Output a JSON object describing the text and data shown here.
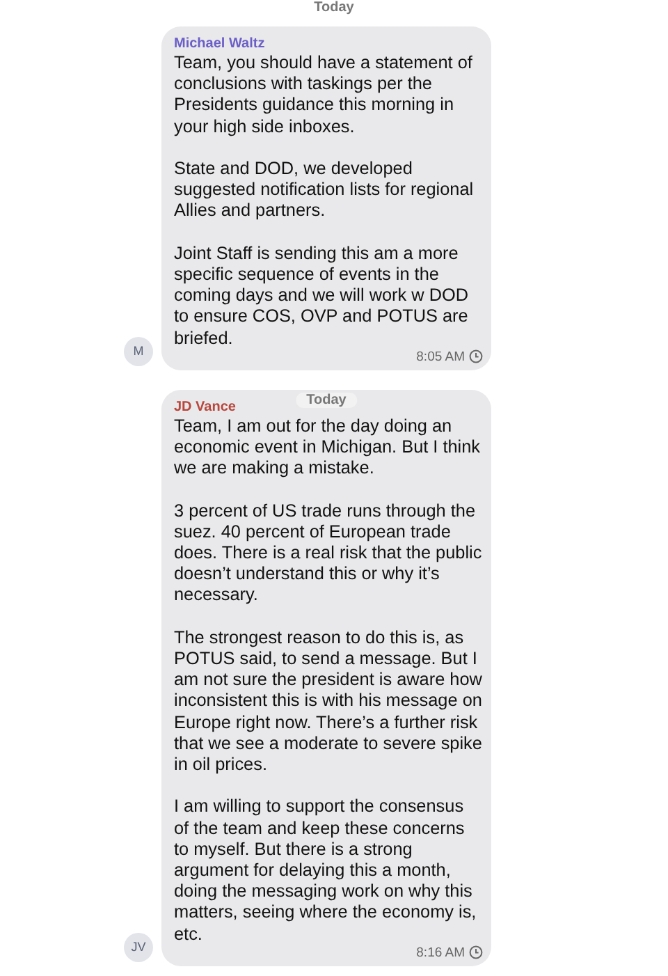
{
  "header_date": "Today",
  "messages": [
    {
      "sender": "Michael Waltz",
      "color": "#6b5fc7",
      "avatar": "M",
      "paragraphs": [
        "Team, you should have a statement of conclusions with taskings per the Presidents guidance this morning in your high side inboxes.",
        "State and DOD, we developed suggested notification lists for regional Allies and partners.",
        "Joint Staff is sending this am a more specific sequence of events in the coming days and we will work w DOD to ensure COS, OVP and POTUS are briefed."
      ],
      "time": "8:05 AM"
    },
    {
      "sender": "JD Vance",
      "color": "#b8473d",
      "avatar": "JV",
      "overlay_date": "Today",
      "paragraphs": [
        "Team, I am out for the day doing an economic event in Michigan. But I think we are making a mistake.",
        "3 percent of US trade runs through the suez. 40 percent of European trade does. There is a real risk that the public doesn’t understand this or why it’s necessary.",
        "The strongest reason to do this is, as POTUS said, to send a message.  But I am not sure the president is aware how inconsistent this is with his message on Europe right now. There’s a further risk that we see a moderate to severe spike in oil prices.",
        "I am willing to support the consensus of the team and keep these concerns to myself. But there is a strong argument for delaying this a month, doing the messaging work on why this matters, seeing where the economy is, etc."
      ],
      "time": "8:16 AM"
    }
  ]
}
